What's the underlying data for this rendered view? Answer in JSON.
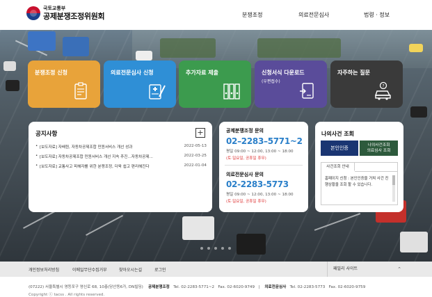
{
  "header": {
    "org_parent": "국토교통부",
    "org_name": "공제분쟁조정위원회",
    "nav": [
      "분쟁조정",
      "의료전문심사",
      "법령 · 정보"
    ]
  },
  "tiles": [
    {
      "label": "분쟁조정 신청",
      "sublabel": "",
      "color": "#e8a33a",
      "icon": "clipboard-form-icon"
    },
    {
      "label": "의료전문심사 신청",
      "sublabel": "",
      "color": "#2f8fd6",
      "icon": "medical-document-icon"
    },
    {
      "label": "추가자료 제출",
      "sublabel": "",
      "color": "#3c9b4e",
      "icon": "binders-icon"
    },
    {
      "label": "신청서식 다운로드",
      "sublabel": "(우편접수)",
      "color": "#5a4c9a",
      "icon": "download-document-icon"
    },
    {
      "label": "자주하는 질문",
      "sublabel": "",
      "color": "#3a3a3a",
      "icon": "car-question-icon"
    }
  ],
  "notice": {
    "title": "공지사항",
    "items": [
      {
        "title": "[보도자료] 자배원, 자동차공제조합 민원서비스 개선 성과",
        "date": "2022-05-13"
      },
      {
        "title": "[보도자료] 자동차공제조합 민원서비스 개선 지속 추진...자동차공제...",
        "date": "2022-03-25"
      },
      {
        "title": "[보도자료] 교통사고 피해자를 위한 분쟁조정, 더욱 쉽고 편리해진다",
        "date": "2022-01-04"
      }
    ]
  },
  "contact": {
    "dispute": {
      "title": "공제분쟁조정 문의",
      "phone": "02–2283–5771~2",
      "hours": "평일 09:00 ~ 12:00, 13:00 ~ 18:00",
      "off": "(토·일요일, 공휴일 휴무)"
    },
    "medical": {
      "title": "의료전문심사 문의",
      "phone": "02-2283-5773",
      "hours": "평일 09:00 ~ 12:00, 13:00 ~ 18:00",
      "off": "(토·일요일, 공휴일 휴무)"
    }
  },
  "lookup": {
    "title": "나의사건 조회",
    "btn_auth": "본인인증",
    "btn_case_line1": "나의사건조회",
    "btn_case_line2": "의료심사 조회",
    "tab": "사건조회 안내",
    "body": "홈페이지 신청 : 본인인증을 거쳐 사건 진행상황을 조회 할 수 있습니다."
  },
  "footer": {
    "links": [
      "개인정보처리방침",
      "이메일무단수집거부",
      "찾아오시는길",
      "로그인"
    ],
    "family_site": "패밀리 사이트",
    "address": "(07222) 서울특별시 영등포구 영신로 68, 10층(당산동6가, DN빌딩)",
    "dispute_label": "공제분쟁조정",
    "dispute_tel": "Tel. 02-2283-5771~2",
    "dispute_fax": "Fax. 02-6020-9749",
    "medical_label": "의료전문심사",
    "medical_tel": "Tel. 02-2283-5773",
    "medical_fax": "Fax. 02-6020-9759",
    "copyright": "Copyright ⓒ tacss . All rights reserved."
  },
  "colors": {
    "accent": "#2a7fc9",
    "navy": "#1a3572",
    "alert": "#dd3333"
  }
}
